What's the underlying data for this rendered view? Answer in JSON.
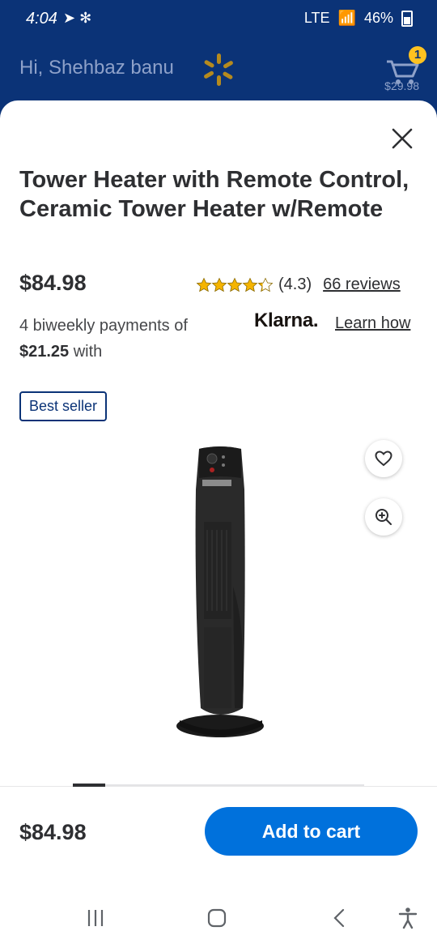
{
  "status": {
    "time": "4:04",
    "network": "LTE",
    "battery": "46%"
  },
  "header": {
    "greeting": "Hi, Shehbaz banu",
    "cart_price": "$29.98",
    "cart_count": "1"
  },
  "product": {
    "title": "Tower Heater with Remote Control, Ceramic Tower Heater w/Remote",
    "price": "$84.98",
    "rating": "(4.3)",
    "reviews": "66 reviews",
    "payment_line": "4 biweekly payments of",
    "payment_amount": "$21.25",
    "payment_suffix": "with",
    "klarna": "Klarna.",
    "learn_how": "Learn how",
    "badge": "Best seller"
  },
  "footer": {
    "price": "$84.98",
    "add_to_cart": "Add to cart"
  },
  "colors": {
    "brand": "#0b3377",
    "cta": "#0071dc",
    "spark": "#ffc220",
    "star": "#f5b400"
  },
  "icons": [
    "close-icon",
    "heart-icon",
    "zoom-icon",
    "cart-icon",
    "spark-icon",
    "recent-apps-icon",
    "home-icon",
    "back-icon",
    "accessibility-icon"
  ]
}
